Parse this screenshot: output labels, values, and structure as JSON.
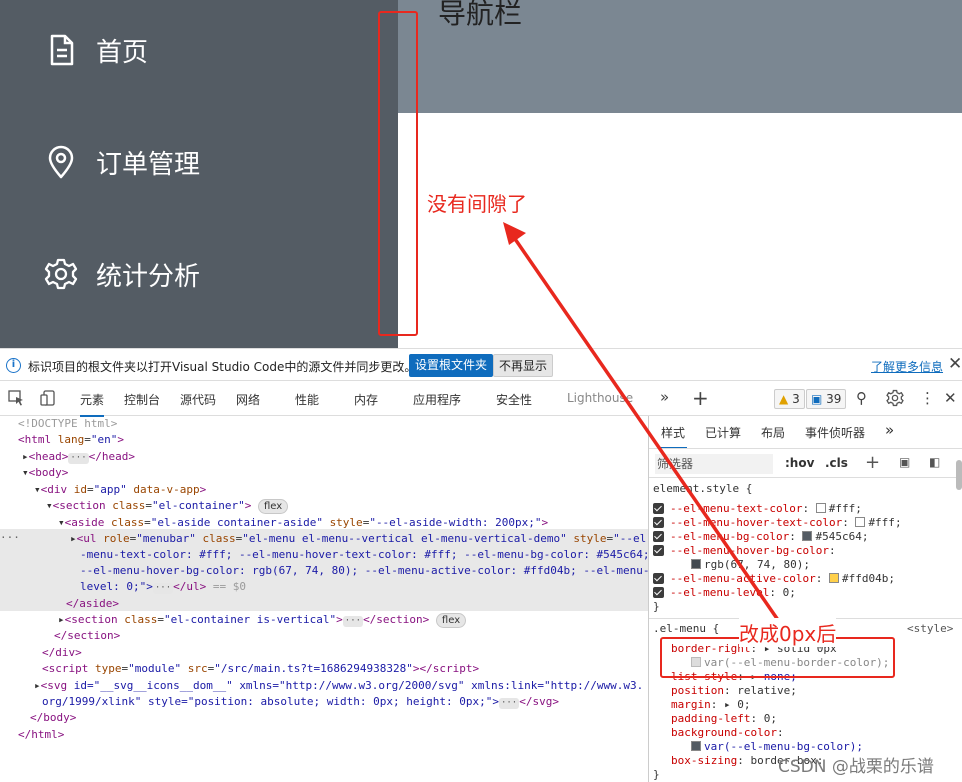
{
  "app": {
    "header_title": "导航栏",
    "menu": [
      {
        "label": "首页",
        "icon": "document-icon"
      },
      {
        "label": "订单管理",
        "icon": "location-pin-icon"
      },
      {
        "label": "统计分析",
        "icon": "gear-icon"
      }
    ],
    "colors": {
      "aside_bg": "#545c64",
      "header_bg": "#7b8792",
      "annotation": "#e8281e"
    }
  },
  "annotations": {
    "gap_note": "没有间隙了",
    "change_note": "改成0px后"
  },
  "infobar": {
    "message": "标识项目的根文件夹以打开Visual Studio Code中的源文件并同步更改。",
    "set_root_button": "设置根文件夹",
    "dont_show_button": "不再显示",
    "learn_more": "了解更多信息"
  },
  "toolbar": {
    "tabs": [
      "元素",
      "控制台",
      "源代码",
      "网络",
      "性能",
      "内存",
      "应用程序",
      "安全性",
      "Lighthouse"
    ],
    "warnings": "3",
    "messages": "39"
  },
  "dom": {
    "lines": {
      "doctype": "<!DOCTYPE html>",
      "html_open": "lang=\"en\"",
      "aside_style": "--el-aside-width: 200px;",
      "ul_l1_cls": "el-menu el-menu--vertical el-menu-vertical-demo",
      "ul_l1_style": "--el",
      "ul_l2": "-menu-text-color: #fff; --el-menu-hover-text-color: #fff; --el-menu-bg-color: #545c64;",
      "ul_l3": "--el-menu-hover-bg-color: rgb(67, 74, 80); --el-menu-active-color: #ffd04b; --el-menu-",
      "ul_l4": "level: 0;\">",
      "ul_tail": "== $0",
      "script_src": "/src/main.ts?t=1686294938328",
      "svg_l1": "id=\"__svg__icons__dom__\" xmlns=\"http://www.w3.org/2000/svg\" xmlns:link=\"http://www.w3.",
      "svg_l2": "org/1999/xlink\" style=\"position: absolute; width: 0px; height: 0px;\">",
      "flex": "flex"
    }
  },
  "styles": {
    "tabs": [
      "样式",
      "已计算",
      "布局",
      "事件侦听器"
    ],
    "filter_placeholder": "筛选器",
    "hov": ":hov",
    "cls": ".cls",
    "element_style": "element.style {",
    "props": [
      {
        "name": "--el-menu-text-color",
        "value": "#fff",
        "color": "#ffffff"
      },
      {
        "name": "--el-menu-hover-text-color",
        "value": "#fff",
        "color": "#ffffff"
      },
      {
        "name": "--el-menu-bg-color",
        "value": "#545c64",
        "color": "#545c64"
      },
      {
        "name": "--el-menu-hover-bg-color",
        "value": "rgb(67, 74, 80);",
        "color": "#434a50"
      },
      {
        "name": "--el-menu-active-color",
        "value": "#ffd04b",
        "color": "#ffd04b"
      },
      {
        "name": "--el-menu-level",
        "value": "0;",
        "color": ""
      }
    ],
    "rule2_selector": ".el-menu {",
    "rule2_source": "<style>",
    "rule2_props": [
      {
        "name": "border-right",
        "value": "solid 0px"
      },
      {
        "name": "",
        "value": "var(--el-menu-border-color);"
      },
      {
        "name": "list-style",
        "value": "none;"
      },
      {
        "name": "position",
        "value": "relative;"
      },
      {
        "name": "margin",
        "value": "0;"
      },
      {
        "name": "padding-left",
        "value": "0;"
      },
      {
        "name": "background-color",
        "value": ""
      },
      {
        "name": "",
        "value": "var(--el-menu-bg-color);"
      },
      {
        "name": "box-sizing",
        "value": "border-box;"
      }
    ]
  },
  "watermark": "CSDN @战栗的乐谱"
}
